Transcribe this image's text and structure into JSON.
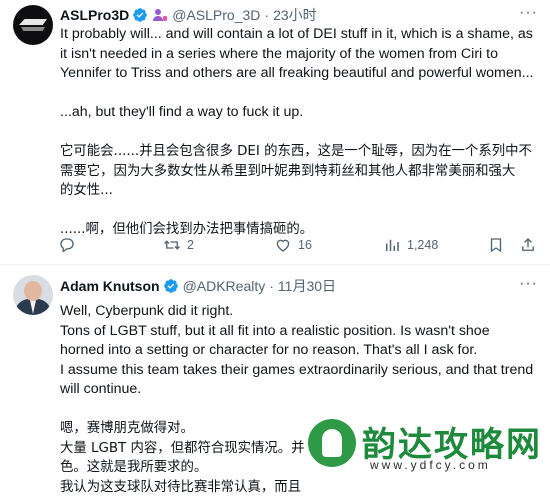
{
  "tweets": [
    {
      "name": "ASLPro3D",
      "handle": "@ASLPro_3D",
      "time": "23小时",
      "lines": [
        "It probably will... and will contain a lot of DEI stuff in it, which is a shame, as",
        "it isn't needed in a series where the majority of the women from Ciri to",
        "Yennifer to Triss and others are all freaking beautiful and powerful women...",
        "",
        "...ah, but they'll find a way to fuck it up.",
        "",
        "它可能会......并且会包含很多 DEI 的东西，这是一个耻辱，因为在一个系列中不",
        "需要它，因为大多数女性从希里到叶妮弗到特莉丝和其他人都非常美丽和强大",
        "的女性...",
        "",
        "......啊，但他们会找到办法把事情搞砸的。"
      ],
      "replies": "",
      "retweets": "2",
      "likes": "16",
      "views": "1,248"
    },
    {
      "name": "Adam Knutson",
      "handle": "@ADKRealty",
      "time": "11月30日",
      "lines": [
        "Well, Cyberpunk did it right.",
        "Tons of LGBT stuff, but it all fit into a realistic position. Is wasn't shoe",
        "horned into a setting or character for no reason. That's all I ask for.",
        "I assume this team takes their games extraordinarily serious, and that trend",
        "will continue.",
        "",
        "嗯，赛博朋克做得对。",
        "大量 LGBT 内容，但都符合现实情况。并",
        "色。这就是我所要求的。",
        "我认为这支球队对待比赛非常认真，而且"
      ]
    }
  ],
  "watermark": {
    "title": "韵达攻略网",
    "url": "www.ydfcy.com"
  },
  "colors": {
    "verified": "#1d9bf0",
    "secondary": "#536471",
    "affiliate": "#9b59d0"
  }
}
